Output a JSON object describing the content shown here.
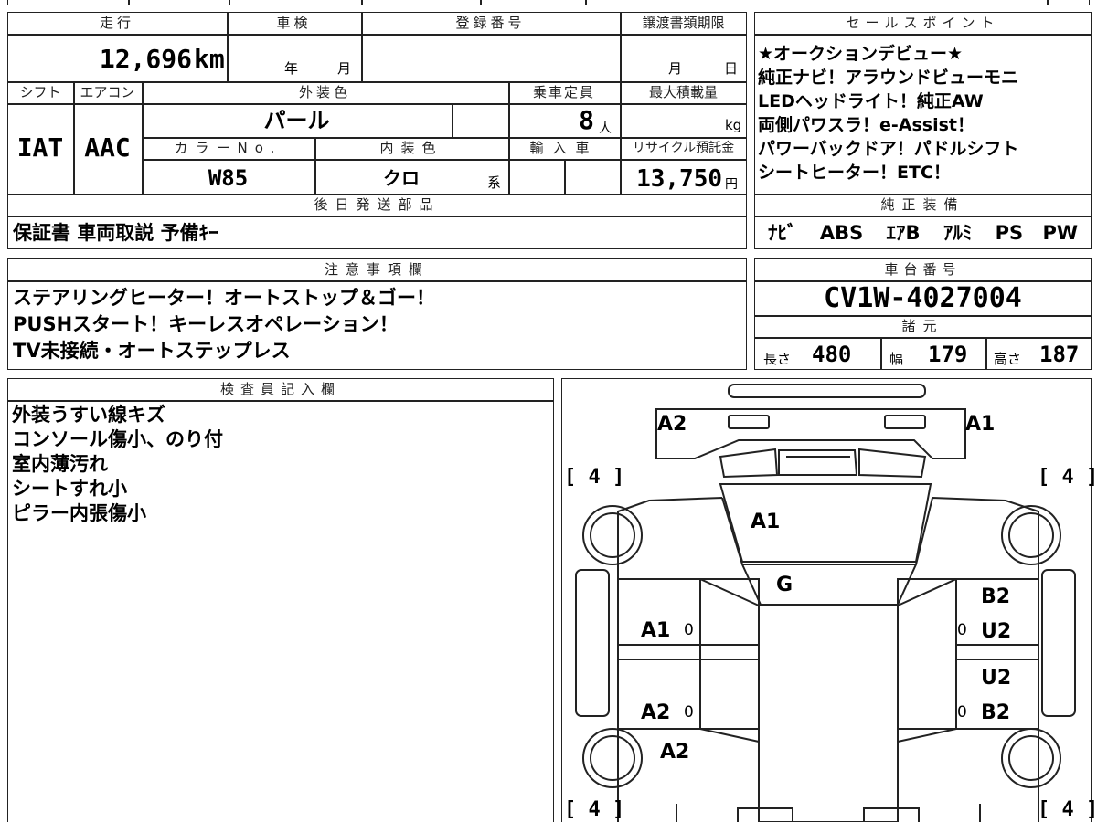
{
  "mileage": {
    "label": "走行",
    "value": "12,696",
    "unit": "km"
  },
  "inspection": {
    "label": "車検",
    "year_label": "年",
    "month_label": "月"
  },
  "registration": {
    "label": "登録番号"
  },
  "transfer_deadline": {
    "label": "譲渡書類期限",
    "month_label": "月",
    "day_label": "日"
  },
  "shift": {
    "label": "シフト",
    "value": "IAT"
  },
  "aircon": {
    "label": "エアコン",
    "value": "AAC"
  },
  "exterior_color": {
    "label": "外装色",
    "value": "パール"
  },
  "capacity": {
    "label": "乗車定員",
    "value": "8",
    "unit": "人"
  },
  "max_load": {
    "label": "最大積載量",
    "unit": "kg"
  },
  "color_no": {
    "label": "カラーNo.",
    "value": "W85"
  },
  "interior_color": {
    "label": "内装色",
    "value": "クロ",
    "suffix": "系"
  },
  "import_car": {
    "label": "輸入車"
  },
  "recycle_fee": {
    "label": "リサイクル預託金",
    "value": "13,750",
    "unit": "円"
  },
  "later_items": {
    "label": "後日発送部品",
    "value": "保証書 車両取説 予備ｷｰ"
  },
  "sales_points": {
    "label": "セールスポイント",
    "lines": [
      "★オークションデビュー★",
      "純正ナビ！アラウンドビューモニ",
      "LEDヘッドライト！純正AW",
      "両側パワスラ！e-Assist！",
      "パワーバックドア！パドルシフト",
      "シートヒーター！ETC！"
    ]
  },
  "genuine_equipment": {
    "label": "純正装備",
    "items": [
      "ﾅﾋﾞ",
      "ABS",
      "ｴｱB",
      "ｱﾙﾐ",
      "PS",
      "PW"
    ]
  },
  "notes": {
    "label": "注意事項欄",
    "lines": [
      "ステアリングヒーター！オートストップ＆ゴー！",
      "PUSHスタート！キーレスオペレーション！",
      "TV未接続・オートステップレス"
    ]
  },
  "chassis": {
    "label": "車台番号",
    "value": "CV1W-4027004"
  },
  "specs": {
    "label": "諸元",
    "length_label": "長さ",
    "length": "480",
    "width_label": "幅",
    "width": "179",
    "height_label": "高さ",
    "height": "187"
  },
  "inspector": {
    "label": "検査員記入欄",
    "lines": [
      "外装うすい線キズ",
      "コンソール傷小、のり付",
      "室内薄汚れ",
      "シートすれ小",
      "ピラー内張傷小"
    ]
  },
  "diagram": {
    "tire_mark": "4",
    "zero": "0",
    "marks": {
      "front_left": "A2",
      "front_right": "A1",
      "hood": "A1",
      "windshield": "G",
      "left_front_door": "A1",
      "left_rear_door": "A2",
      "left_rear": "A2",
      "right_front_1": "B2",
      "right_front_2": "U2",
      "right_rear_1": "U2",
      "right_rear_2": "B2"
    }
  }
}
